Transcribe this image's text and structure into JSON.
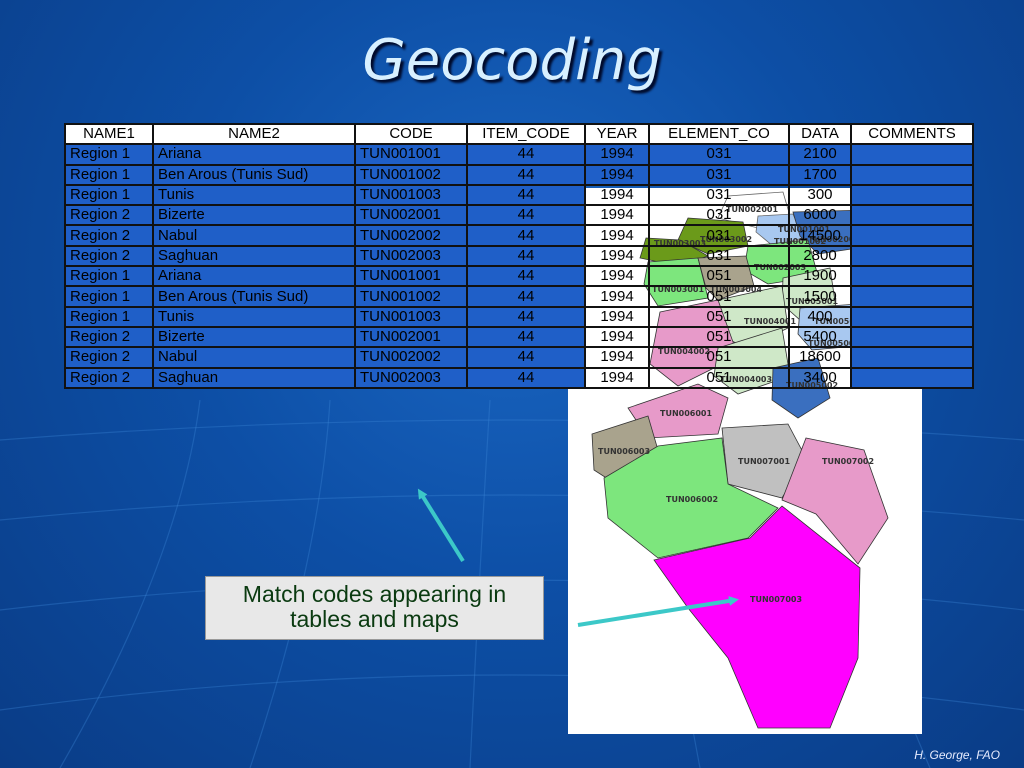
{
  "title": "Geocoding",
  "table": {
    "headers": [
      "NAME1",
      "NAME2",
      "CODE",
      "ITEM_CODE",
      "YEAR",
      "ELEMENT_CO",
      "DATA",
      "COMMENTS"
    ],
    "rows": [
      [
        "Region 1",
        "Ariana",
        "TUN001001",
        "44",
        "1994",
        "031",
        "2100",
        ""
      ],
      [
        "Region 1",
        "Ben Arous (Tunis Sud)",
        "TUN001002",
        "44",
        "1994",
        "031",
        "1700",
        ""
      ],
      [
        "Region 1",
        "Tunis",
        "TUN001003",
        "44",
        "1994",
        "031",
        "300",
        ""
      ],
      [
        "Region 2",
        "Bizerte",
        "TUN002001",
        "44",
        "1994",
        "031",
        "6000",
        ""
      ],
      [
        "Region 2",
        "Nabul",
        "TUN002002",
        "44",
        "1994",
        "031",
        "14500",
        ""
      ],
      [
        "Region 2",
        "Saghuan",
        "TUN002003",
        "44",
        "1994",
        "031",
        "2800",
        ""
      ],
      [
        "Region 1",
        "Ariana",
        "TUN001001",
        "44",
        "1994",
        "051",
        "1900",
        ""
      ],
      [
        "Region 1",
        "Ben Arous (Tunis Sud)",
        "TUN001002",
        "44",
        "1994",
        "051",
        "1500",
        ""
      ],
      [
        "Region 1",
        "Tunis",
        "TUN001003",
        "44",
        "1994",
        "051",
        "400",
        ""
      ],
      [
        "Region 2",
        "Bizerte",
        "TUN002001",
        "44",
        "1994",
        "051",
        "5400",
        ""
      ],
      [
        "Region 2",
        "Nabul",
        "TUN002002",
        "44",
        "1994",
        "051",
        "18600",
        ""
      ],
      [
        "Region 2",
        "Saghuan",
        "TUN002003",
        "44",
        "1994",
        "051",
        "3400",
        ""
      ]
    ]
  },
  "map": {
    "labels": [
      "TUN002001",
      "TUN001001",
      "TUN003002",
      "TUN001002",
      "TUN002002",
      "TUN003003",
      "TUN002003",
      "TUN003001",
      "TUN003004",
      "TUN005001",
      "TUN004001",
      "TUN005003",
      "TUN004002",
      "TUN005004",
      "TUN004003",
      "TUN005002",
      "TUN006001",
      "TUN006003",
      "TUN007001",
      "TUN007002",
      "TUN006002",
      "TUN007003"
    ],
    "colors": {
      "magenta": "#ff00ff",
      "pink": "#e79ac9",
      "green": "#7de67d",
      "gray": "#a9a38d",
      "lightgray": "#c0c0c0",
      "lightgreen": "#cfe8c8",
      "lightblue": "#a8c8f0",
      "steel": "#3a6fbf",
      "olive": "#6b9a1a"
    }
  },
  "callout": {
    "line1": "Match codes appearing in",
    "line2": "tables and maps"
  },
  "footer": "H. George, FAO"
}
